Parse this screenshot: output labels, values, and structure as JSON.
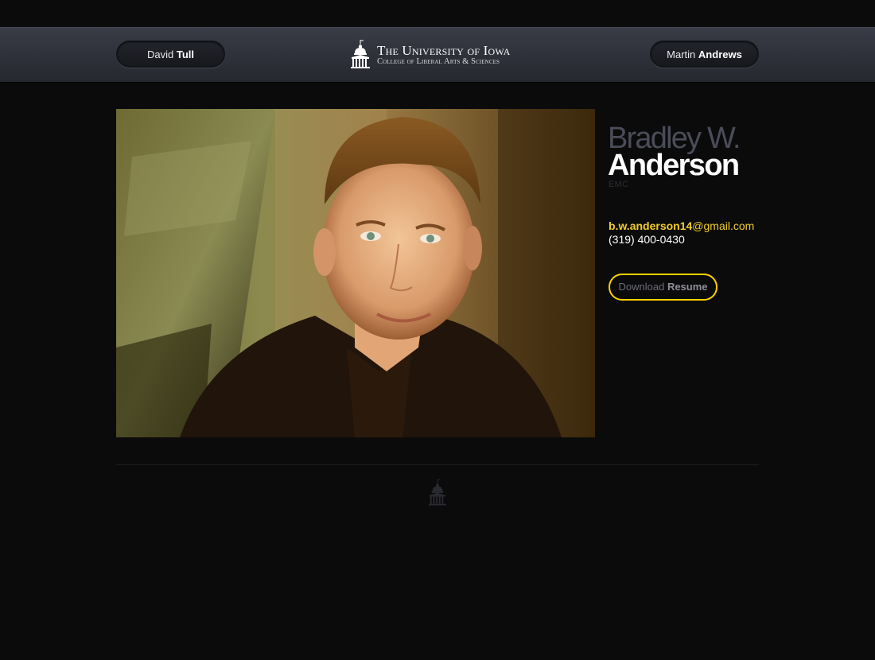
{
  "header": {
    "prev": {
      "first": "David",
      "last": "Tull"
    },
    "next": {
      "first": "Martin",
      "last": "Andrews"
    },
    "logo": {
      "line1": "The University of Iowa",
      "line2": "College of Liberal Arts & Sciences"
    }
  },
  "profile": {
    "first_name": "Bradley W.",
    "last_name": "Anderson",
    "department": "EMC",
    "email_user": "b.w.anderson14",
    "email_domain": "@gmail.com",
    "phone": "(319) 400-0430",
    "resume": {
      "prefix": "Download",
      "emphasis": "Resume"
    }
  },
  "colors": {
    "accent": "#ffd100",
    "email": "#f2cd29",
    "background": "#0b0b0c",
    "header": "#30333c"
  },
  "icons": {
    "logo": "old-capitol-dome-icon",
    "footer": "old-capitol-dome-icon"
  }
}
